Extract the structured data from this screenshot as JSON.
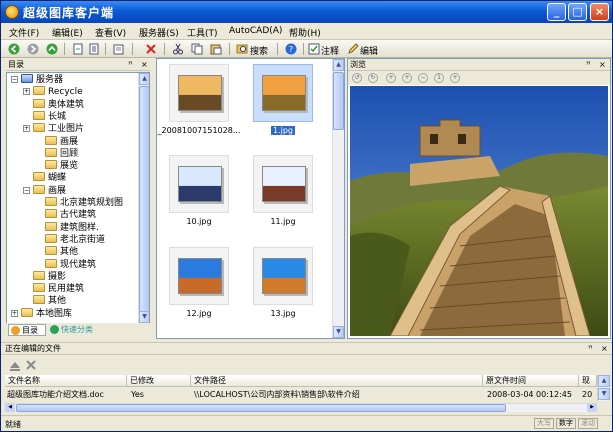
{
  "window": {
    "title": "超级图库客户端",
    "controls": {
      "minimize": "_",
      "maximize": "□",
      "close": "×"
    }
  },
  "menu": [
    "文件(F)",
    "编辑(E)",
    "查看(V)",
    "服务器(S)",
    "工具(T)",
    "AutoCAD(A)",
    "帮助(H)"
  ],
  "toolbar": {
    "search_label": "搜索",
    "annotate_label": "注释",
    "edit_label": "编辑"
  },
  "tree": {
    "title": "目录",
    "items": [
      {
        "label": "服务器",
        "level": 0
      },
      {
        "label": "Recycle",
        "level": 1
      },
      {
        "label": "奥体建筑",
        "level": 1
      },
      {
        "label": "长城",
        "level": 1
      },
      {
        "label": "工业图片",
        "level": 1
      },
      {
        "label": "画展",
        "level": 2
      },
      {
        "label": "回顾",
        "level": 2
      },
      {
        "label": "展览",
        "level": 2
      },
      {
        "label": "蝴蝶",
        "level": 1
      },
      {
        "label": "画展",
        "level": 1
      },
      {
        "label": "北京建筑规划图",
        "level": 2
      },
      {
        "label": "古代建筑",
        "level": 2
      },
      {
        "label": "建筑图样.",
        "level": 2
      },
      {
        "label": "老北京街道",
        "level": 2
      },
      {
        "label": "其他",
        "level": 2
      },
      {
        "label": "现代建筑",
        "level": 2
      },
      {
        "label": "摄影",
        "level": 1
      },
      {
        "label": "民用建筑",
        "level": 1
      },
      {
        "label": "其他",
        "level": 1
      },
      {
        "label": "本地图库",
        "level": 0
      }
    ],
    "tabs": {
      "catalog": "目录",
      "quick": "快速分类"
    }
  },
  "files": {
    "items": [
      {
        "label": "_20081007151028...",
        "selected": false
      },
      {
        "label": "1.jpg",
        "selected": true
      },
      {
        "label": "10.jpg",
        "selected": false
      },
      {
        "label": "11.jpg",
        "selected": false
      },
      {
        "label": "12.jpg",
        "selected": false
      },
      {
        "label": "13.jpg",
        "selected": false
      }
    ]
  },
  "preview": {
    "title": "浏览"
  },
  "editing": {
    "title": "正在编辑的文件",
    "columns": [
      "文件名称",
      "已修改",
      "文件路径",
      "原文件时间",
      "现"
    ],
    "rows": [
      {
        "name": "超级图库功能介绍文档.doc",
        "modified": "Yes",
        "path": "\\\\LOCALHOST\\公司内部资料\\销售部\\软件介绍",
        "time": "2008-03-04 00:12:45",
        "extra": "20"
      }
    ]
  },
  "status": {
    "ready": "就绪",
    "caps": "大写",
    "num": "数字",
    "scroll": "滚动"
  },
  "colors": {
    "titlebar": "#0a5ad6",
    "selection": "#316ac5"
  }
}
